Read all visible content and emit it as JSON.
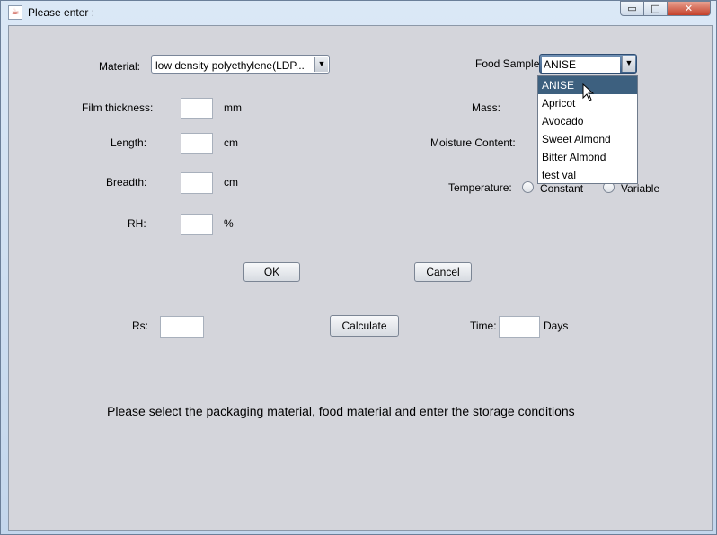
{
  "window": {
    "title": "Please enter :",
    "controls": {
      "minimize": "▭",
      "maximize": "□",
      "close": "✕"
    }
  },
  "form": {
    "material_label": "Material:",
    "material_value": "low density polyethylene(LDP...",
    "food_sample_label": "Food Sample:",
    "food_sample_value": "ANISE",
    "film_thickness_label": "Film thickness:",
    "film_thickness_unit": "mm",
    "length_label": "Length:",
    "length_unit": "cm",
    "breadth_label": "Breadth:",
    "breadth_unit": "cm",
    "rh_label": "RH:",
    "rh_unit": "%",
    "mass_label": "Mass:",
    "moisture_label": "Moisture Content:",
    "temperature_label": "Temperature:",
    "temperature_options": [
      "Constant",
      "Variable"
    ],
    "ok_label": "OK",
    "cancel_label": "Cancel",
    "rs_label": "Rs:",
    "calculate_label": "Calculate",
    "time_label": "Time:",
    "time_unit": "Days"
  },
  "dropdown": {
    "items": [
      "ANISE",
      "Apricot",
      "Avocado",
      "Sweet Almond",
      "Bitter Almond",
      "test val"
    ],
    "selected_index": 0
  },
  "instruction": "Please select the packaging material, food material and enter the storage conditions",
  "arrow_glyph": "▼",
  "icons": {
    "app": "java-coffee-icon"
  }
}
